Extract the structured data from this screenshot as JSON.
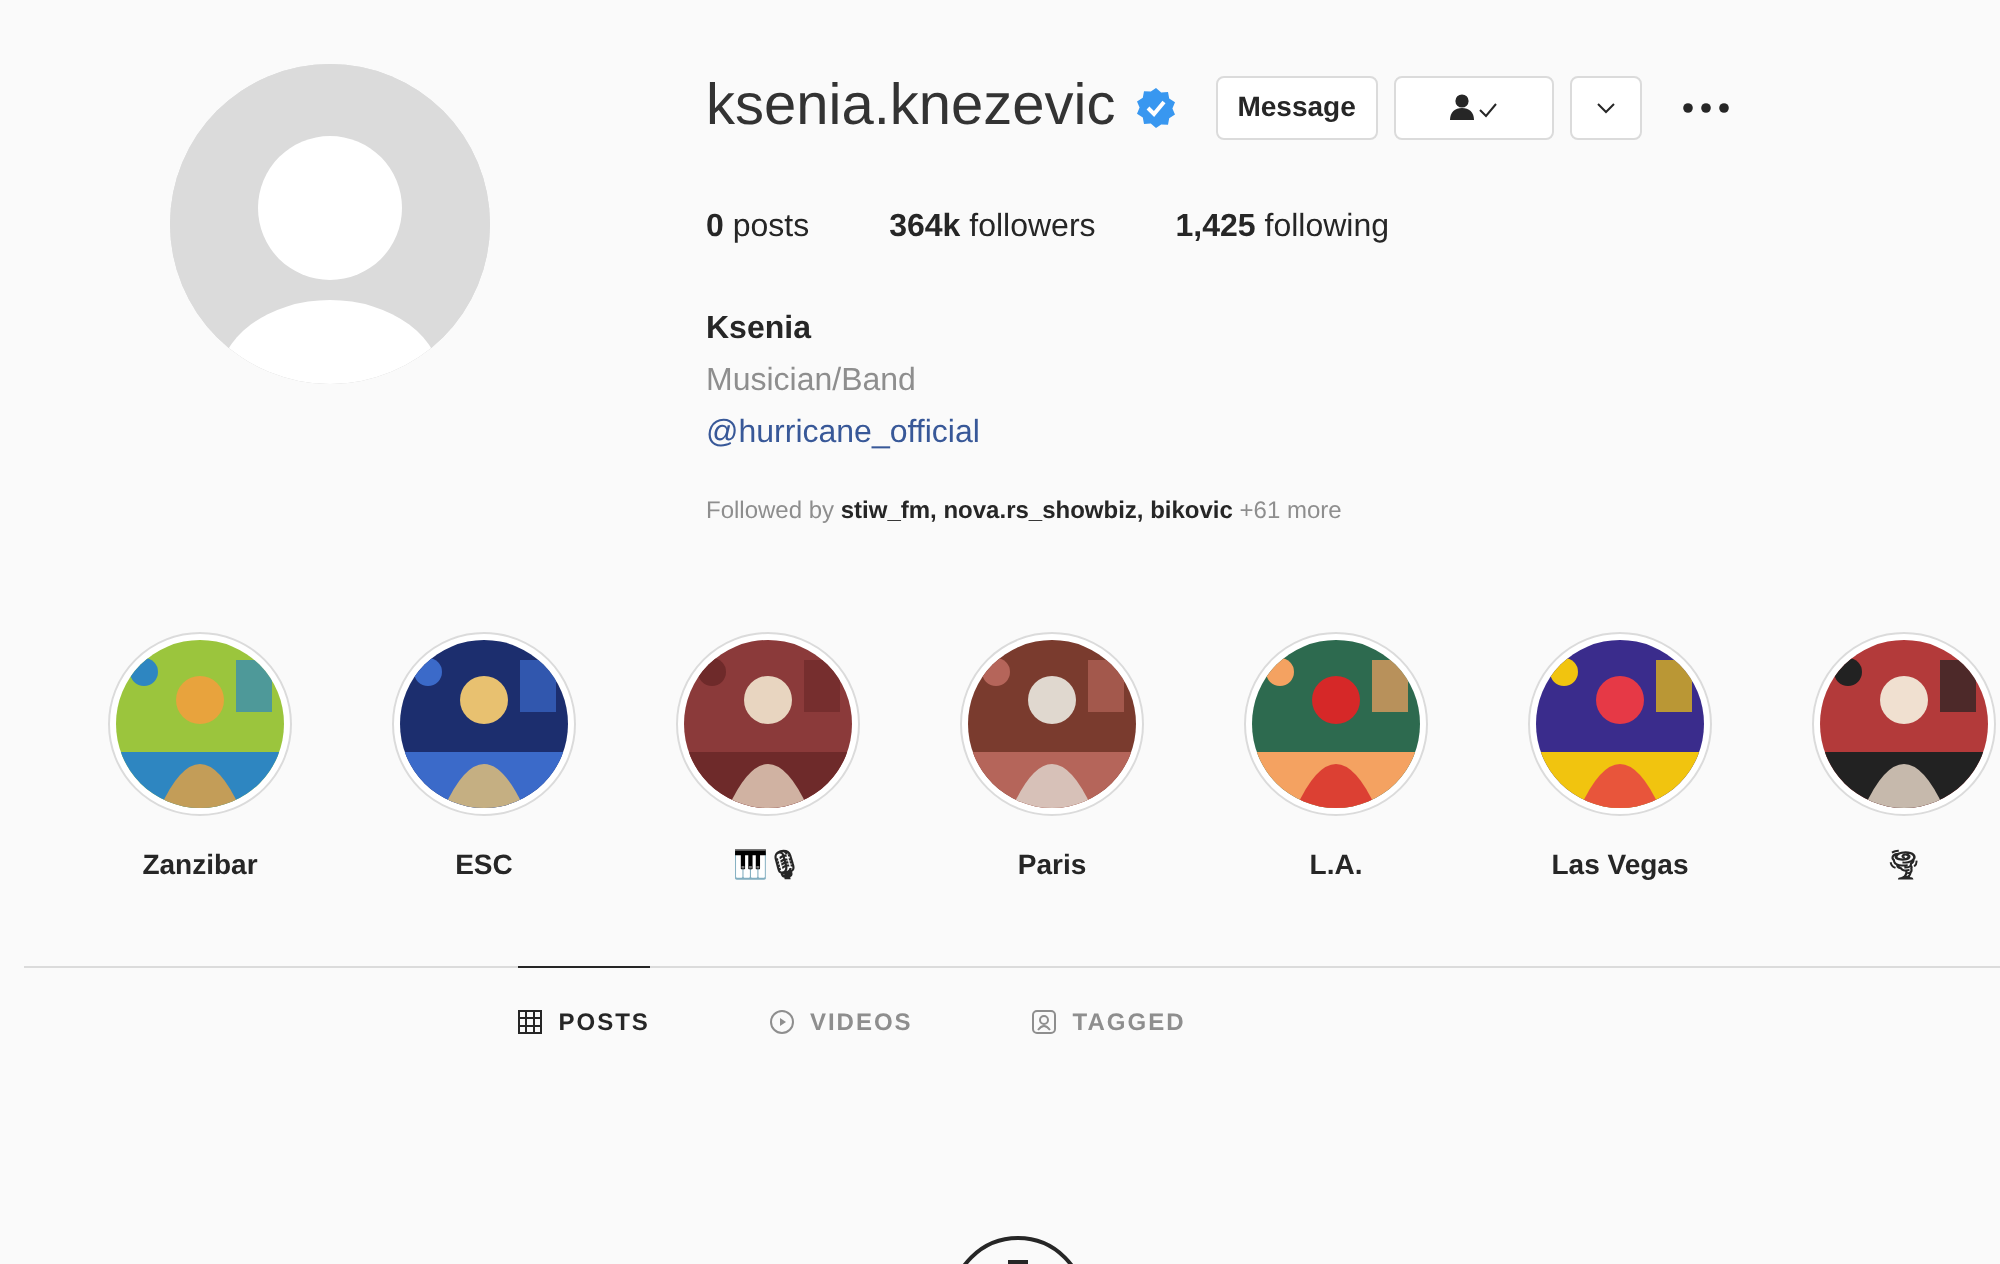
{
  "profile": {
    "username": "ksenia.knezevic",
    "verified": true,
    "buttons": [
      "Message"
    ],
    "stats": [
      {
        "value": "0",
        "label": "posts"
      },
      {
        "value": "364k",
        "label": "followers"
      },
      {
        "value": "1,425",
        "label": "following"
      }
    ],
    "name": "Ksenia",
    "category": "Musician/Band",
    "link": "@hurricane_official",
    "followed_by": {
      "prefix": "Followed by",
      "names": "stiw_fm, nova.rs_showbiz, bikovic",
      "more": "+61 more"
    }
  },
  "highlights": [
    {
      "label": "Zanzibar",
      "kind": "picture"
    },
    {
      "label": "ESC",
      "kind": "picture"
    },
    {
      "label": "🎹🎙",
      "kind": "picture"
    },
    {
      "label": "Paris",
      "kind": "picture"
    },
    {
      "label": "L.A.",
      "kind": "picture"
    },
    {
      "label": "Las Vegas",
      "kind": "picture"
    },
    {
      "label": "🌪",
      "kind": "picture"
    }
  ],
  "tabs": [
    {
      "label": "POSTS",
      "selected": true,
      "kind": "grid"
    },
    {
      "label": "VIDEOS",
      "selected": false,
      "kind": "play"
    },
    {
      "label": "TAGGED",
      "selected": false,
      "kind": "tag"
    }
  ]
}
